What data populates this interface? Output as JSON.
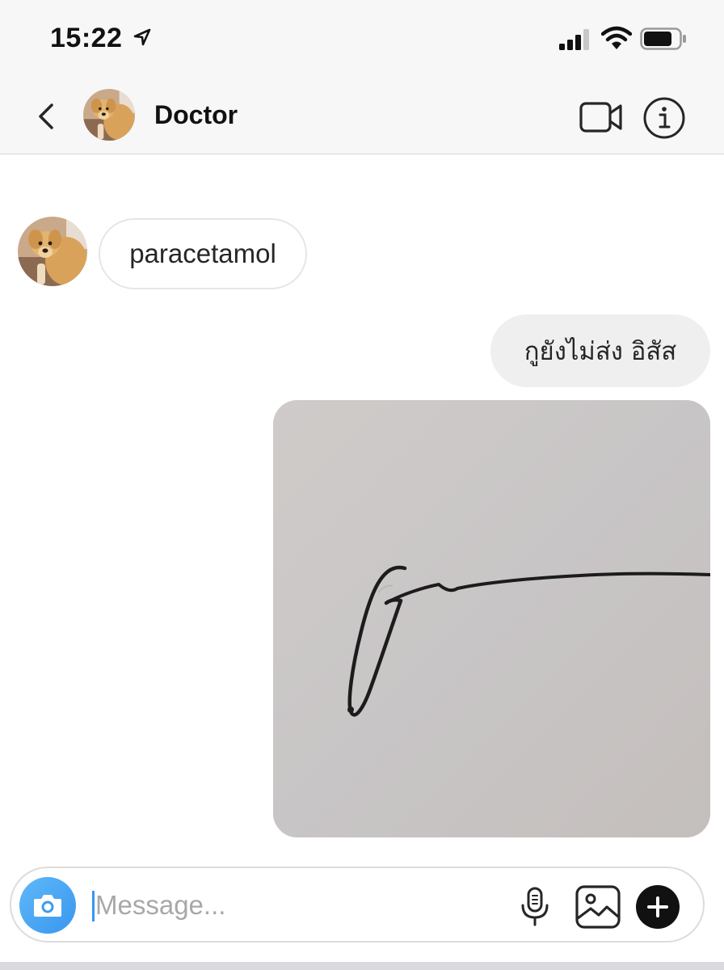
{
  "status_bar": {
    "time": "15:22",
    "icons": [
      "location-arrow-icon",
      "cellular-signal-icon",
      "wifi-icon",
      "battery-icon"
    ]
  },
  "header": {
    "contact_name": "Doctor",
    "icons": [
      "chevron-left-icon",
      "video-camera-icon",
      "info-icon"
    ]
  },
  "messages": [
    {
      "direction": "incoming",
      "type": "text",
      "text": "paracetamol"
    },
    {
      "direction": "outgoing",
      "type": "text",
      "text": "กูยังไม่ส่ง อิสัส"
    },
    {
      "direction": "outgoing",
      "type": "image",
      "content": "handwritten-signature-photo"
    }
  ],
  "composer": {
    "placeholder": "Message...",
    "value": "",
    "icons": [
      "camera-icon",
      "microphone-icon",
      "gallery-icon",
      "plus-icon"
    ]
  },
  "colors": {
    "accent_blue": "#3897f0",
    "header_bg": "#f7f7f7",
    "outgoing_bubble": "#efefef",
    "photo_paper": "#cbc7c5"
  }
}
